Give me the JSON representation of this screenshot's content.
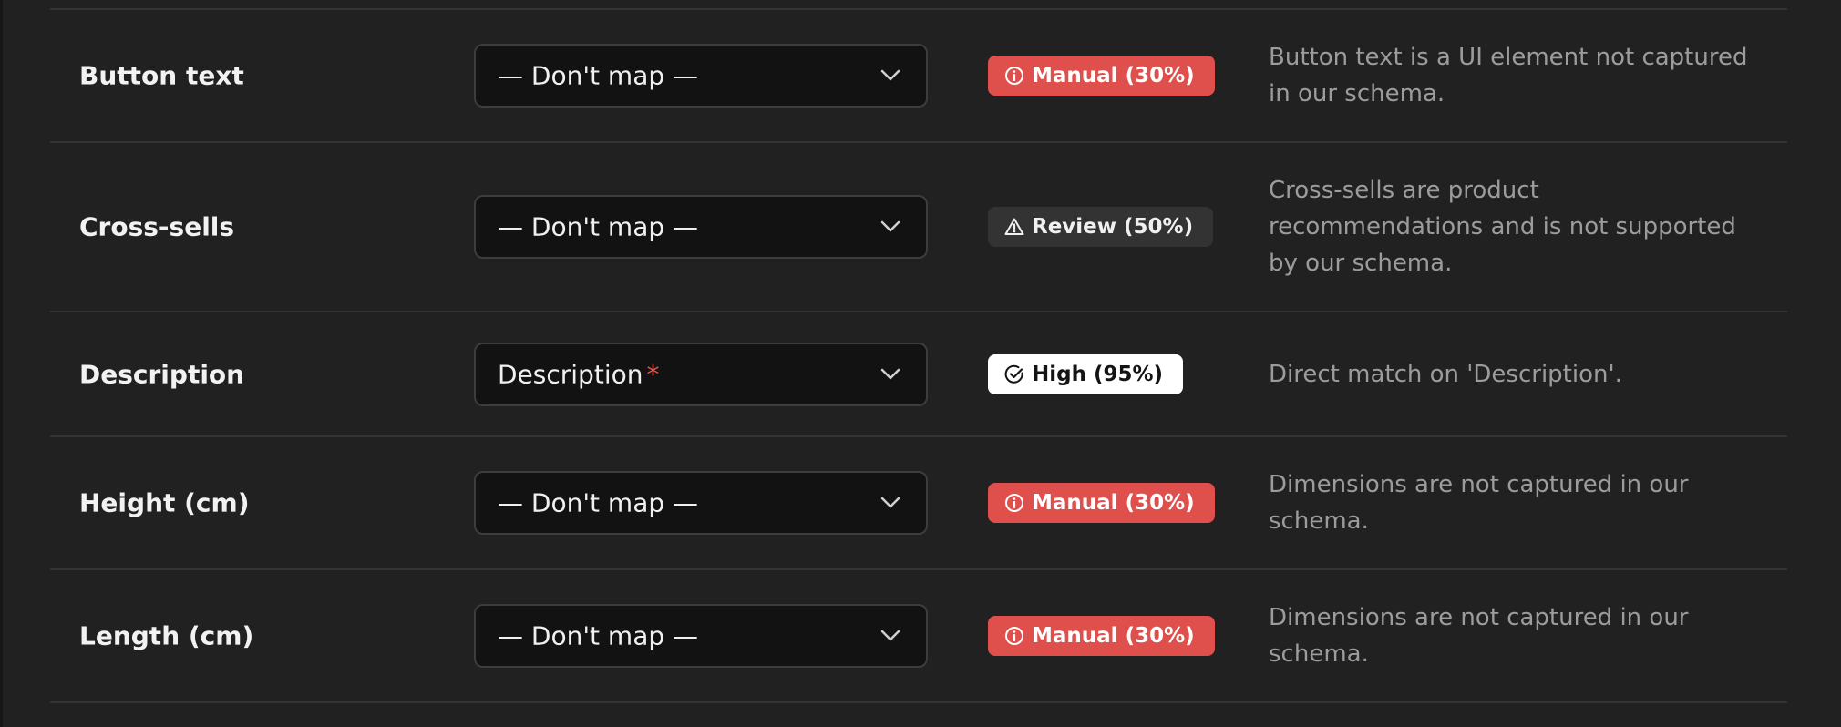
{
  "rows": [
    {
      "field": "Button text",
      "mapping": "— Don't map —",
      "required": "",
      "confidence": {
        "label": "Manual (30%)",
        "level": "manual",
        "icon": "info-circle-icon",
        "color": "#df4f4b"
      },
      "reason": "Button text is a UI element not captured in our schema."
    },
    {
      "field": "Cross-sells",
      "mapping": "— Don't map —",
      "required": "",
      "confidence": {
        "label": "Review (50%)",
        "level": "review",
        "icon": "warning-triangle-icon",
        "color": "#333333"
      },
      "reason": "Cross-sells are product recommendations and is not supported by our schema."
    },
    {
      "field": "Description",
      "mapping": "Description",
      "required": "*",
      "confidence": {
        "label": "High (95%)",
        "level": "high",
        "icon": "check-circle-icon",
        "color": "#ffffff"
      },
      "reason": "Direct match on 'Description'."
    },
    {
      "field": "Height (cm)",
      "mapping": "— Don't map —",
      "required": "",
      "confidence": {
        "label": "Manual (30%)",
        "level": "manual",
        "icon": "info-circle-icon",
        "color": "#df4f4b"
      },
      "reason": "Dimensions are not captured in our schema."
    },
    {
      "field": "Length (cm)",
      "mapping": "— Don't map —",
      "required": "",
      "confidence": {
        "label": "Manual (30%)",
        "level": "manual",
        "icon": "info-circle-icon",
        "color": "#df4f4b"
      },
      "reason": "Dimensions are not captured in our schema."
    }
  ],
  "theme": {
    "background": "#212121",
    "divider": "#333333",
    "select_bg": "#121212",
    "required_color": "#e5554f"
  }
}
